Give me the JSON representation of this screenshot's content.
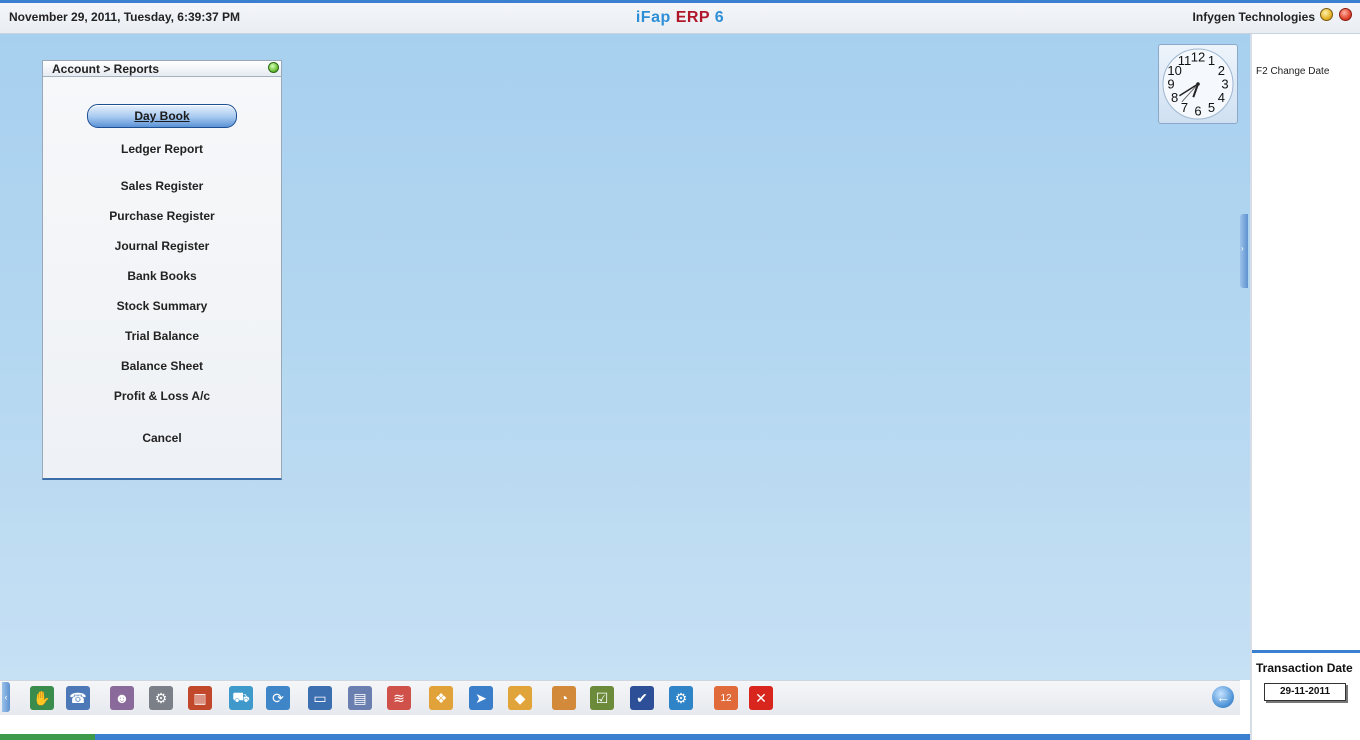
{
  "topbar": {
    "datetime": "November  29, 2011, Tuesday, 6:39:37 PM",
    "app_title_part1": "iFap",
    "app_title_part2": "ERP",
    "app_title_part3": "6",
    "company": "Infygen Technologies"
  },
  "clock": {
    "hour": 6,
    "minute": 39,
    "second": 37
  },
  "dialog": {
    "title": "Account > Reports",
    "items": [
      {
        "label": "Day Book",
        "selected": true
      },
      {
        "label": "Ledger Report"
      },
      {
        "label": "Sales Register"
      },
      {
        "label": "Purchase Register"
      },
      {
        "label": "Journal Register"
      },
      {
        "label": "Bank Books"
      },
      {
        "label": "Stock Summary"
      },
      {
        "label": "Trial Balance"
      },
      {
        "label": "Balance Sheet"
      },
      {
        "label": "Profit & Loss A/c"
      },
      {
        "label": "Cancel"
      }
    ]
  },
  "right_panel": {
    "shortcut": "F2 Change Date",
    "transaction_label": "Transaction Date",
    "transaction_date": "29-11-2011"
  },
  "colors": {
    "accent": "#3b7fd0",
    "brand_red": "#b0182a",
    "brand_blue": "#2f8fd6"
  },
  "taskbar": {
    "icons": [
      {
        "name": "hand-money-icon",
        "color": "#3a8c4c",
        "glyph": "✋"
      },
      {
        "name": "user-phone-icon",
        "color": "#4d78b8",
        "glyph": "☎"
      },
      {
        "name": "people-icon",
        "color": "#8a6a9a",
        "glyph": "☻"
      },
      {
        "name": "gears-icon",
        "color": "#7a7f88",
        "glyph": "⚙"
      },
      {
        "name": "books-icon",
        "color": "#c2482c",
        "glyph": "▥"
      },
      {
        "name": "cart-icon",
        "color": "#3f9acb",
        "glyph": "⛟"
      },
      {
        "name": "refresh-icon",
        "color": "#3f86c9",
        "glyph": "⟳"
      },
      {
        "name": "window-icon",
        "color": "#3b6fb0",
        "glyph": "▭"
      },
      {
        "name": "document-icon",
        "color": "#6a7fb0",
        "glyph": "▤"
      },
      {
        "name": "tape-icon",
        "color": "#d0504a",
        "glyph": "≋"
      },
      {
        "name": "tree-icon",
        "color": "#e2a23a",
        "glyph": "❖"
      },
      {
        "name": "arrow-icon",
        "color": "#3a7ec9",
        "glyph": "➤"
      },
      {
        "name": "box-icon",
        "color": "#e0a43a",
        "glyph": "◆"
      },
      {
        "name": "dial-icon",
        "color": "#d2893a",
        "glyph": "◔"
      },
      {
        "name": "checklist-icon",
        "color": "#6b8a3a",
        "glyph": "☑"
      },
      {
        "name": "save-icon",
        "color": "#2c4f98",
        "glyph": "✔"
      },
      {
        "name": "settings-icon",
        "color": "#2f84c8",
        "glyph": "⚙"
      },
      {
        "name": "calendar-icon",
        "color": "#e06a3a",
        "glyph": "12"
      },
      {
        "name": "close-icon",
        "color": "#d8261e",
        "glyph": "✕"
      }
    ]
  }
}
